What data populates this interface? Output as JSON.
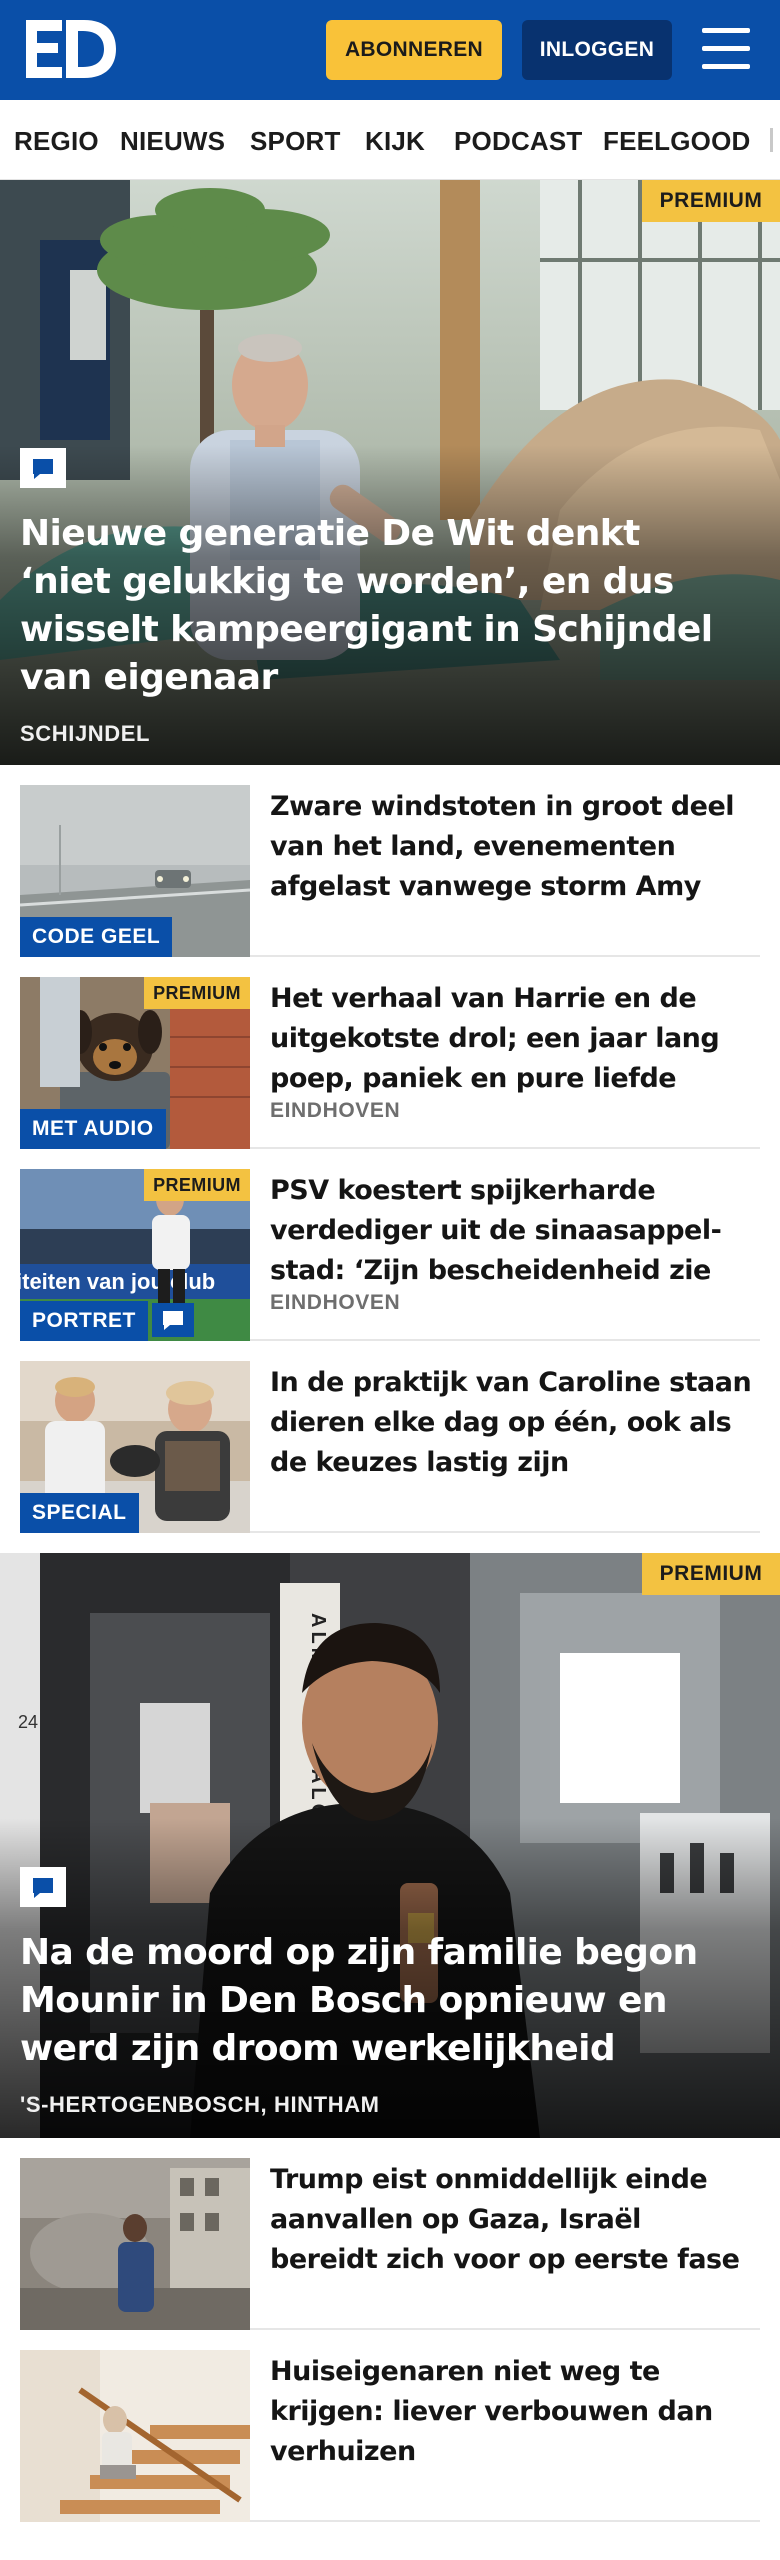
{
  "header": {
    "logo_text": "ED",
    "subscribe_label": "ABONNEREN",
    "login_label": "INLOGGEN",
    "menu_icon": "hamburger-menu-icon",
    "brand_color": "#0a4fa8",
    "accent_color": "#f9c239"
  },
  "nav": {
    "items": [
      "REGIO",
      "NIEUWS",
      "SPORT",
      "KIJK",
      "PODCAST",
      "FEELGOOD"
    ]
  },
  "hero1": {
    "badge": "PREMIUM",
    "comment_icon": "comment-icon",
    "title": "Nieuwe generatie De Wit denkt ‘niet gelukkig te worden’, en dus wisselt kampeergigant in Schijndel van eigenaar",
    "location": "SCHIJNDEL"
  },
  "articles": [
    {
      "label": "CODE GEEL",
      "premium": "",
      "title": "Zware windstoten in groot deel van het land, evenementen afgelast vanwege storm Amy",
      "location": ""
    },
    {
      "label": "MET AUDIO",
      "premium": "PREMIUM",
      "title": "Het verhaal van Harrie en de uitgekotste drol; een jaar lang poep, paniek en pure liefde",
      "location": "EINDHOVEN"
    },
    {
      "label": "PORTRET",
      "premium": "PREMIUM",
      "title": "PSV koestert spijkerharde verdediger uit de sinaasappel-stad: ‘Zijn bescheidenheid zie je…",
      "location": "EINDHOVEN"
    },
    {
      "label": "SPECIAL",
      "premium": "",
      "title": "In de praktijk van Caroline staan dieren elke dag op één, ook als de keuzes lastig zijn",
      "location": ""
    }
  ],
  "hero2": {
    "badge": "PREMIUM",
    "comment_icon": "comment-icon",
    "title": "Na de moord op zijn familie begon Mounir in Den Bosch opnieuw en werd zijn droom werkelijkheid",
    "location": "'S-HERTOGENBOSCH, HINTHAM",
    "shop_sign": "ALMANAR SALON",
    "house_number": "24"
  },
  "articles2": [
    {
      "title": "Trump eist onmiddellijk einde aanvallen op Gaza, Israël bereidt zich voor op eerste fase staakt-…"
    },
    {
      "title": "Huiseigenaren niet weg te krijgen: liever verbouwen dan verhuizen"
    }
  ],
  "thumb_texts": {
    "stadium_banner": "iteiten van jou club"
  }
}
